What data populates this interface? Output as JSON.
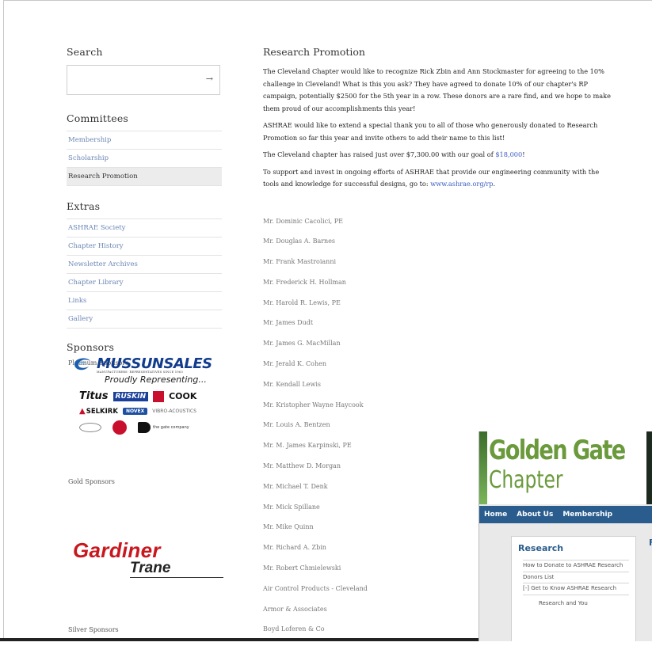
{
  "sidebar": {
    "search": {
      "heading": "Search",
      "arrow": "→",
      "placeholder": ""
    },
    "committees": {
      "heading": "Committees",
      "items": [
        {
          "label": "Membership"
        },
        {
          "label": "Scholarship"
        },
        {
          "label": "Research Promotion",
          "active": true
        }
      ]
    },
    "extras": {
      "heading": "Extras",
      "items": [
        {
          "label": "ASHRAE Society"
        },
        {
          "label": "Chapter History"
        },
        {
          "label": "Newsletter Archives"
        },
        {
          "label": "Chapter Library"
        },
        {
          "label": "Links"
        },
        {
          "label": "Gallery"
        }
      ]
    },
    "sponsors": {
      "heading": "Sponsors",
      "platinum_label": "Platinum Sponsors",
      "gold_label": "Gold Sponsors",
      "silver_label": "Silver Sponsors",
      "platinum_logo": {
        "title": "MUSSUNSALES",
        "subtitle": "MANUFACTURERS' REPRESENTATIVES SINCE 1963",
        "tagline": "Proudly Representing...",
        "brands_row1": [
          "Titus",
          "RUSKIN",
          "COOK"
        ],
        "brands_row2": [
          "SELKIRK",
          "NOVEX",
          "VIBRO-ACOUSTICS"
        ],
        "brands_row3": [
          "the gate company"
        ]
      },
      "gold_logo": {
        "name": "Gardiner",
        "sub": "Trane"
      }
    }
  },
  "main": {
    "title": "Research Promotion",
    "paragraphs": {
      "p1": "The Cleveland Chapter would like to recognize Rick Zbin and Ann Stockmaster for agreeing to the 10% challenge in Cleveland! What is this you ask? They have agreed to donate 10% of our chapter's RP campaign, potentially $2500 for the 5th year in a row. These donors are a rare find, and we hope to make them proud of our accomplishments this year!",
      "p2": "ASHRAE would like to extend a special thank you to all of those who generously donated to Research Promotion so far this year and invite others to add their name to this list!",
      "p3_prefix": "The Cleveland chapter has raised just over $7,300.00 with our goal of ",
      "p3_goal": "$18,000",
      "p3_suffix": "!",
      "p4_prefix": "To support and invest in ongoing efforts of ASHRAE that provide our engineering community with the tools and knowledge for successful designs, go to: ",
      "p4_link": "www.ashrae.org/rp",
      "p4_suffix": "."
    },
    "donors": [
      "Mr. Dominic Cacolici, PE",
      "Mr. Douglas A. Barnes",
      "Mr. Frank Mastroianni",
      "Mr. Frederick H. Hollman",
      "Mr. Harold R. Lewis, PE",
      "Mr. James Dudt",
      "Mr. James G. MacMillan",
      "Mr. Jerald K. Cohen",
      "Mr. Kendall Lewis",
      "Mr. Kristopher Wayne Haycook",
      "Mr. Louis A. Bentzen",
      "Mr. M. James Karpinski, PE",
      "Mr. Matthew D. Morgan",
      "Mr. Michael T. Denk",
      "Mr. Mick Spillane",
      "Mr. Mike Quinn",
      "Mr. Richard A. Zbin",
      "Mr. Robert Chmielewski",
      "Air Control Products - Cleveland",
      "Armor & Associates",
      "Boyd Loferen & Co"
    ]
  },
  "inset": {
    "title": "Golden Gate",
    "subtitle": "Chapter",
    "nav": [
      "Home",
      "About Us",
      "Membership"
    ],
    "box_title": "Research",
    "right_letter": "F",
    "links": [
      "How to Donate to ASHRAE Research",
      "Donors List",
      "[-] Get to Know ASHRAE Research"
    ],
    "sub_link": "Research and You"
  },
  "colors": {
    "link": "#6b86b5",
    "gardiner_red": "#c9171e",
    "gg_green": "#6b9a3c",
    "gg_nav": "#2a5d8e"
  }
}
